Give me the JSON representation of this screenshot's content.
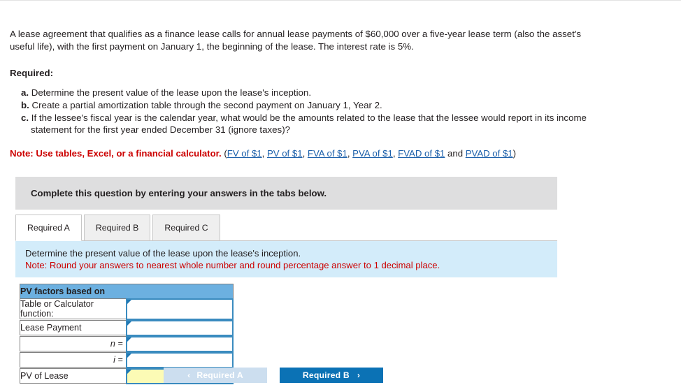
{
  "problem": {
    "statement": "A lease agreement that qualifies as a finance lease calls for annual lease payments of $60,000 over a five-year lease term (also the asset's useful life), with the first payment on January 1, the beginning of the lease. The interest rate is 5%.",
    "required_heading": "Required:",
    "requirements": [
      {
        "marker": "a.",
        "text": "Determine the present value of the lease upon the lease's inception."
      },
      {
        "marker": "b.",
        "text": "Create a partial amortization table through the second payment on January 1, Year 2."
      },
      {
        "marker": "c.",
        "text": "If the lessee's fiscal year is the calendar year, what would be the amounts related to the lease that the lessee would report in its income statement for the first year ended December 31 (ignore taxes)?"
      }
    ]
  },
  "note": {
    "label": "Note: Use tables, Excel, or a financial calculator.",
    "open_paren": "(",
    "close_paren": ")",
    "and_word": " and ",
    "links": [
      {
        "text": "FV of $1",
        "sep": ", "
      },
      {
        "text": "PV of $1",
        "sep": ", "
      },
      {
        "text": "FVA of $1",
        "sep": ", "
      },
      {
        "text": "PVA of $1",
        "sep": ", "
      },
      {
        "text": "FVAD of $1",
        "sep": ""
      },
      {
        "text": "PVAD of $1",
        "sep": ""
      }
    ]
  },
  "banner": {
    "text": "Complete this question by entering your answers in the tabs below."
  },
  "tabs": [
    {
      "label": "Required A",
      "active": true
    },
    {
      "label": "Required B",
      "active": false
    },
    {
      "label": "Required C",
      "active": false
    }
  ],
  "instruction": {
    "line1": "Determine the present value of the lease upon the lease's inception.",
    "line2": "Note: Round your answers to nearest whole number and round percentage answer to 1 decimal place."
  },
  "answer_table": {
    "header": "PV factors based on",
    "rows": [
      {
        "label": "Table or Calculator function:",
        "align": "left",
        "value": "",
        "highlight": false
      },
      {
        "label": "Lease Payment",
        "align": "left",
        "value": "",
        "highlight": false
      },
      {
        "label": "n =",
        "align": "right",
        "value": "",
        "highlight": false
      },
      {
        "label": "i =",
        "align": "right",
        "value": "",
        "highlight": false
      },
      {
        "label": "PV of Lease",
        "align": "left",
        "value": "",
        "highlight": true
      }
    ]
  },
  "navigation": {
    "prev_label": "Required A",
    "prev_chevron": "‹",
    "next_label": "Required B",
    "next_chevron": "›"
  },
  "colors": {
    "note_red": "#cc0000",
    "link_blue": "#1b5faa",
    "banner_gray": "#dededf",
    "panel_blue": "#d3ecfa",
    "table_header_blue": "#6cb0e0",
    "input_border_blue": "#3a8bbf",
    "highlight_yellow": "#fcfbb5",
    "next_button_blue": "#0b72b5",
    "prev_button_blue": "#ccdeef"
  }
}
